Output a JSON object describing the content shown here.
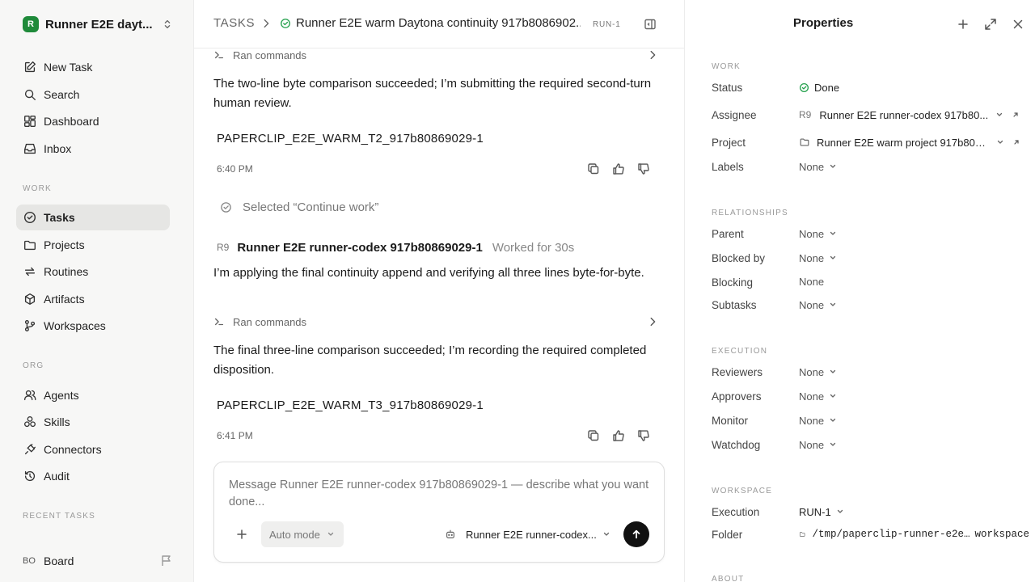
{
  "sidebar": {
    "workspace_logo": "R",
    "workspace_name": "Runner E2E dayt...",
    "primary": [
      {
        "label": "New Task",
        "icon": "pencil-square-icon"
      },
      {
        "label": "Search",
        "icon": "search-icon"
      },
      {
        "label": "Dashboard",
        "icon": "dashboard-icon"
      },
      {
        "label": "Inbox",
        "icon": "inbox-icon"
      }
    ],
    "work_section": "WORK",
    "work": [
      {
        "label": "Tasks",
        "icon": "check-circle-icon",
        "active": true
      },
      {
        "label": "Projects",
        "icon": "folder-icon"
      },
      {
        "label": "Routines",
        "icon": "repeat-icon"
      },
      {
        "label": "Artifacts",
        "icon": "box-icon"
      },
      {
        "label": "Workspaces",
        "icon": "git-branch-icon"
      }
    ],
    "org_section": "ORG",
    "org": [
      {
        "label": "Agents",
        "icon": "users-icon"
      },
      {
        "label": "Skills",
        "icon": "skills-icon"
      },
      {
        "label": "Connectors",
        "icon": "plug-icon"
      },
      {
        "label": "Audit",
        "icon": "history-icon"
      }
    ],
    "recent_section": "RECENT TASKS",
    "board": {
      "avatar": "BO",
      "label": "Board"
    }
  },
  "header": {
    "breadcrumb_root": "TASKS",
    "task_title": "Runner E2E warm Daytona continuity 917b8086902...",
    "task_id": "RUN-1"
  },
  "feed": {
    "commands_label": "Ran commands",
    "message1": "The two-line byte comparison succeeded; I’m submitting the required second-turn human review.",
    "code1": "PAPERCLIP_E2E_WARM_T2_917b80869029-1",
    "time1": "6:40 PM",
    "selected_text": "Selected “Continue work”",
    "author_avatar": "R9",
    "author_name": "Runner E2E runner-codex 917b80869029-1",
    "worked_for": "Worked for 30s",
    "message2": "I’m applying the final continuity append and verifying all three lines byte-for-byte.",
    "message3": "The final three-line comparison succeeded; I’m recording the required completed disposition.",
    "code2": "PAPERCLIP_E2E_WARM_T3_917b80869029-1",
    "time2": "6:41 PM"
  },
  "composer": {
    "placeholder": "Message Runner E2E runner-codex 917b80869029-1 — describe what you want done...",
    "mode": "Auto mode",
    "agent": "Runner E2E runner-codex..."
  },
  "properties": {
    "title": "Properties",
    "work_section": "WORK",
    "status_label": "Status",
    "status_value": "Done",
    "assignee_label": "Assignee",
    "assignee_avatar": "R9",
    "assignee_value": "Runner E2E runner-codex 917b80...",
    "project_label": "Project",
    "project_value": "Runner E2E warm project 917b8086...",
    "labels_label": "Labels",
    "labels_value": "None",
    "relationships_section": "RELATIONSHIPS",
    "parent_label": "Parent",
    "parent_value": "None",
    "blocked_by_label": "Blocked by",
    "blocked_by_value": "None",
    "blocking_label": "Blocking",
    "blocking_value": "None",
    "subtasks_label": "Subtasks",
    "subtasks_value": "None",
    "execution_section": "EXECUTION",
    "reviewers_label": "Reviewers",
    "reviewers_value": "None",
    "approvers_label": "Approvers",
    "approvers_value": "None",
    "monitor_label": "Monitor",
    "monitor_value": "None",
    "watchdog_label": "Watchdog",
    "watchdog_value": "None",
    "workspace_section": "WORKSPACE",
    "execution_label": "Execution",
    "execution_value": "RUN-1",
    "folder_label": "Folder",
    "folder_value": "/tmp/paperclip-runner-e2e…",
    "folder_suffix": "workspace",
    "about_section": "ABOUT"
  },
  "colors": {
    "accent_done": "#22a04b",
    "logo": "#1f8a3a",
    "send": "#111111"
  }
}
